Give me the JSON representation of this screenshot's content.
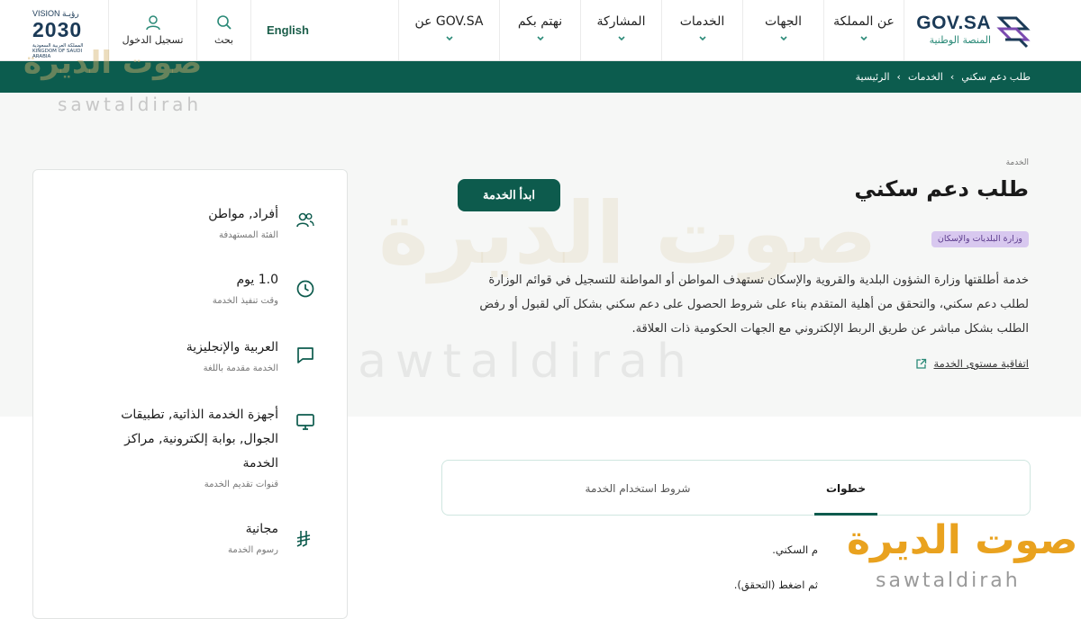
{
  "header": {
    "logo_title": "GOV.SA",
    "logo_subtitle": "المنصة الوطنية",
    "nav": [
      "عن المملكة",
      "الجهات",
      "الخدمات",
      "المشاركة",
      "نهتم بكم",
      "عن GOV.SA"
    ],
    "language": "English",
    "search": "بحث",
    "login": "تسجيل الدخول",
    "vision": {
      "top": "VISION رؤيـة",
      "year": "2030",
      "sub": "المملكة العربية السعودية KINGDOM OF SAUDI ARABIA"
    }
  },
  "breadcrumb": [
    "الرئيسية",
    "الخدمات",
    "طلب دعم سكني"
  ],
  "service": {
    "kicker": "الخدمة",
    "title": "طلب دعم سكني",
    "start_button": "ابدأ الخدمة",
    "ministry": "وزارة البلديات والإسكان",
    "description": "خدمة أطلقتها وزارة الشؤون البلدية والقروية والإسكان تستهدف المواطن أو المواطنة للتسجيل في قوائم الوزارة لطلب دعم سكني، والتحقق من أهلية المتقدم بناء على شروط الحصول على دعم سكني بشكل آلي لقبول أو رفض الطلب بشكل مباشر عن طريق الربط الإلكتروني مع الجهات الحكومية ذات العلاقة.",
    "sla_link": "اتفاقية مستوى الخدمة"
  },
  "info": [
    {
      "icon": "users-icon",
      "value": "أفراد, مواطن",
      "label": "الفئة المستهدفة"
    },
    {
      "icon": "clock-icon",
      "value": "1.0 يوم",
      "label": "وقت تنفيذ الخدمة"
    },
    {
      "icon": "chat-icon",
      "value": "العربية والإنجليزية",
      "label": "الخدمة مقدمة باللغة"
    },
    {
      "icon": "monitor-icon",
      "value": "أجهزة الخدمة الذاتية, تطبيقات الجوال, بوابة إلكترونية, مراكز الخدمة",
      "label": "قنوات تقديم الخدمة"
    },
    {
      "icon": "riyal-icon",
      "value": "مجانية",
      "label": "رسوم الخدمة"
    }
  ],
  "tabs": {
    "steps": "خطوات",
    "terms": "شروط استخدام الخدمة"
  },
  "steps": [
    "م السكني.",
    "ثم اضغط (التحقق)."
  ],
  "watermark": {
    "arabic": "صوت الديرة",
    "latin": "sawtaldirah"
  },
  "colors": {
    "primary": "#0d5b4d",
    "badge_bg": "#d8c8ef",
    "badge_text": "#5b3b8c",
    "watermark": "#e9a21f"
  }
}
